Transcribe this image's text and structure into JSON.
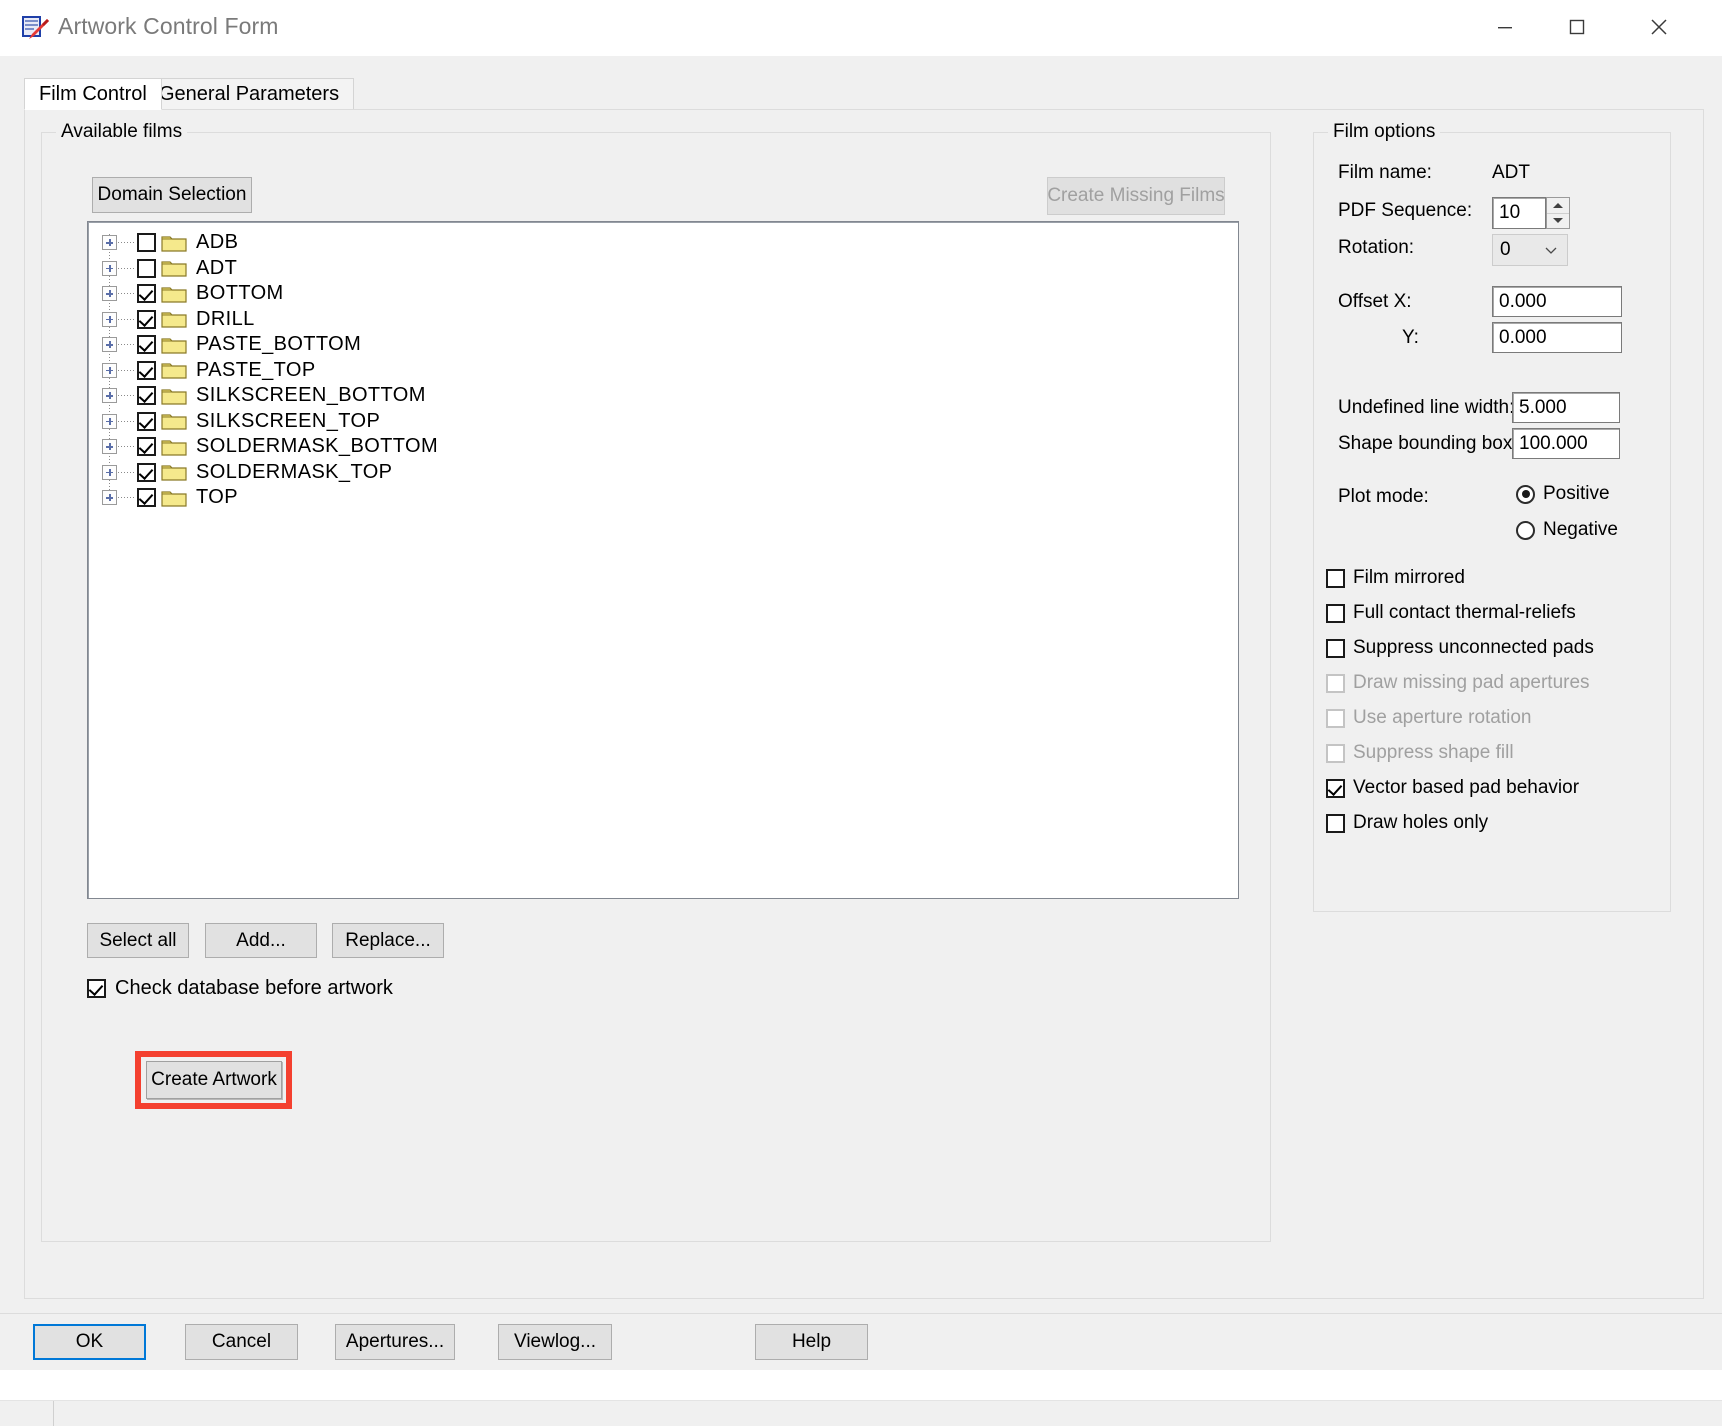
{
  "window": {
    "title": "Artwork Control Form",
    "icon": "artwork-app-icon",
    "minimize": "minimize-icon",
    "maximize": "maximize-icon",
    "close": "close-icon"
  },
  "tabs": [
    {
      "label": "Film Control",
      "active": true
    },
    {
      "label": "General Parameters",
      "active": false
    }
  ],
  "available_films": {
    "group_title": "Available films",
    "domain_selection_label": "Domain Selection",
    "create_missing_films_label": "Create Missing Films",
    "create_missing_films_enabled": false,
    "items": [
      {
        "label": "ADB",
        "checked": false
      },
      {
        "label": "ADT",
        "checked": false
      },
      {
        "label": "BOTTOM",
        "checked": true
      },
      {
        "label": "DRILL",
        "checked": true
      },
      {
        "label": "PASTE_BOTTOM",
        "checked": true
      },
      {
        "label": "PASTE_TOP",
        "checked": true
      },
      {
        "label": "SILKSCREEN_BOTTOM",
        "checked": true
      },
      {
        "label": "SILKSCREEN_TOP",
        "checked": true
      },
      {
        "label": "SOLDERMASK_BOTTOM",
        "checked": true
      },
      {
        "label": "SOLDERMASK_TOP",
        "checked": true
      },
      {
        "label": "TOP",
        "checked": true
      }
    ],
    "select_all_label": "Select all",
    "add_label": "Add...",
    "replace_label": "Replace...",
    "check_database_label": "Check database before artwork",
    "check_database_checked": true,
    "create_artwork_label": "Create Artwork",
    "highlight_color": "#f4402f"
  },
  "film_options": {
    "group_title": "Film options",
    "film_name_label": "Film name:",
    "film_name_value": "ADT",
    "pdf_sequence_label": "PDF Sequence:",
    "pdf_sequence_value": "10",
    "rotation_label": "Rotation:",
    "rotation_value": "0",
    "offset_x_label": "Offset  X:",
    "offset_x_value": "0.000",
    "offset_y_label": "Y:",
    "offset_y_value": "0.000",
    "undefined_line_width_label": "Undefined line width:",
    "undefined_line_width_value": "5.000",
    "shape_bounding_box_label": "Shape bounding box:",
    "shape_bounding_box_value": "100.000",
    "plot_mode_label": "Plot mode:",
    "plot_mode_options": [
      {
        "label": "Positive",
        "selected": true
      },
      {
        "label": "Negative",
        "selected": false
      }
    ],
    "checkboxes": [
      {
        "label": "Film mirrored",
        "checked": false,
        "enabled": true
      },
      {
        "label": "Full contact thermal-reliefs",
        "checked": false,
        "enabled": true
      },
      {
        "label": "Suppress unconnected pads",
        "checked": false,
        "enabled": true
      },
      {
        "label": "Draw missing pad apertures",
        "checked": false,
        "enabled": false
      },
      {
        "label": "Use aperture rotation",
        "checked": false,
        "enabled": false
      },
      {
        "label": "Suppress shape fill",
        "checked": false,
        "enabled": false
      },
      {
        "label": "Vector based pad behavior",
        "checked": true,
        "enabled": true
      },
      {
        "label": "Draw holes only",
        "checked": false,
        "enabled": true
      }
    ]
  },
  "footer": {
    "ok_label": "OK",
    "cancel_label": "Cancel",
    "apertures_label": "Apertures...",
    "viewlog_label": "Viewlog...",
    "help_label": "Help",
    "focus_color": "#0078d7"
  }
}
